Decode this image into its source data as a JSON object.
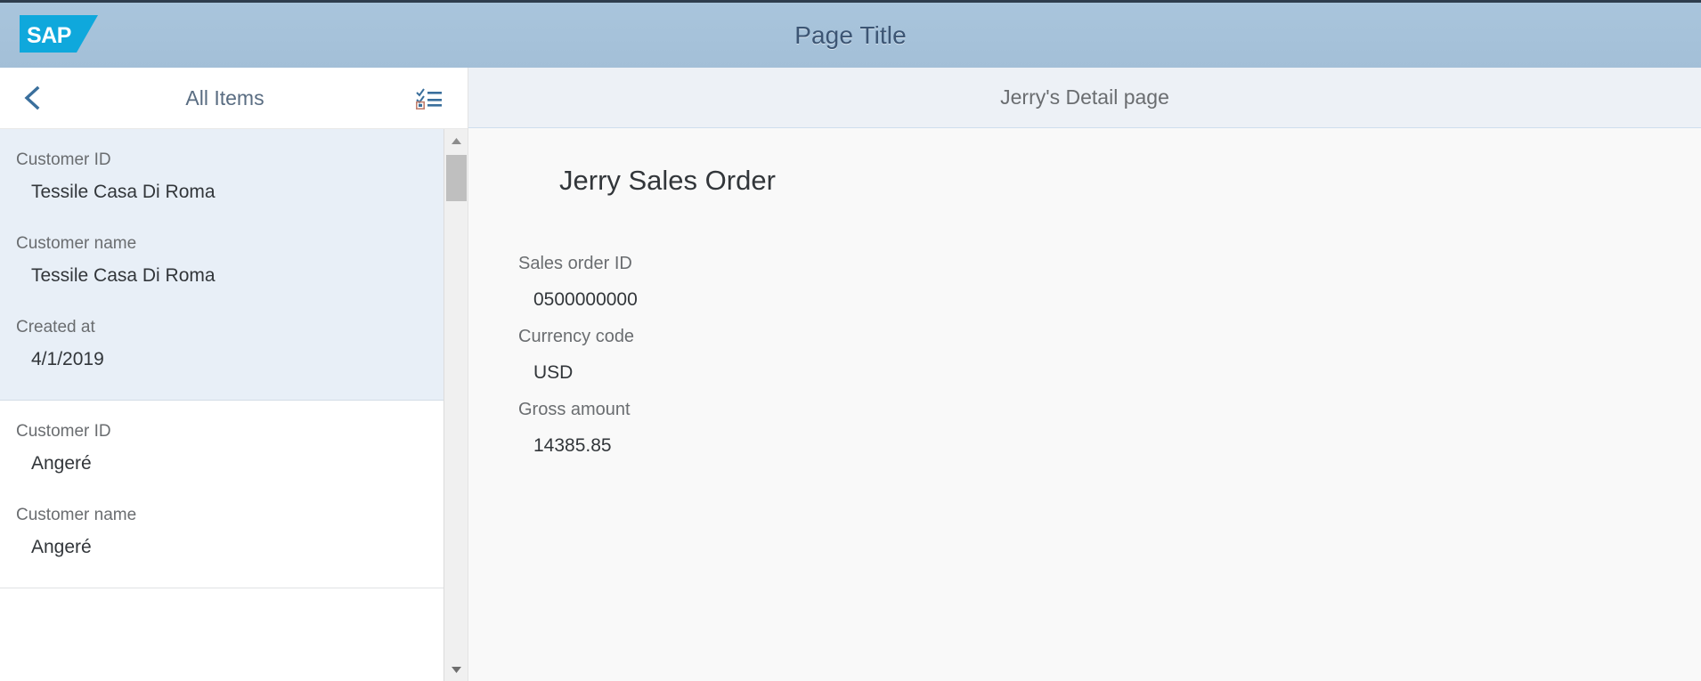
{
  "shell": {
    "logo_text": "SAP",
    "logo_color": "#0fa8dc",
    "title": "Page Title",
    "title_color": "#3c5574",
    "bar_color": "#a6c2da"
  },
  "master": {
    "back_icon": "chevron-left-icon",
    "header_title": "All Items",
    "multiselect_icon": "multi-select-icon",
    "scrollbar": {
      "up_icon": "triangle-up-icon",
      "down_icon": "triangle-down-icon"
    },
    "items": [
      {
        "selected": true,
        "fields": [
          {
            "label": "Customer ID",
            "value": "Tessile Casa Di Roma"
          },
          {
            "label": "Customer name",
            "value": "Tessile Casa Di Roma"
          },
          {
            "label": "Created at",
            "value": "4/1/2019"
          }
        ]
      },
      {
        "selected": false,
        "fields": [
          {
            "label": "Customer ID",
            "value": "Angeré"
          },
          {
            "label": "Customer name",
            "value": "Angeré"
          }
        ]
      }
    ]
  },
  "detail": {
    "header_title": "Jerry's Detail page",
    "title": "Jerry Sales Order",
    "fields": [
      {
        "label": "Sales order ID",
        "value": "0500000000"
      },
      {
        "label": "Currency code",
        "value": "USD"
      },
      {
        "label": "Gross amount",
        "value": "14385.85"
      }
    ]
  }
}
